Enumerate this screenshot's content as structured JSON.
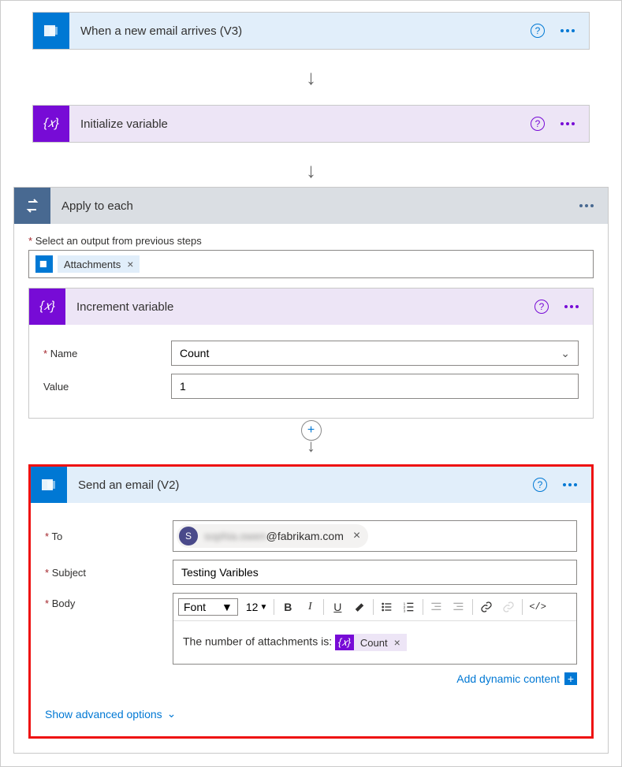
{
  "steps": {
    "trigger": {
      "title": "When a new email arrives (V3)"
    },
    "init_var": {
      "title": "Initialize variable"
    },
    "apply": {
      "title": "Apply to each",
      "select_label": "Select an output from previous steps",
      "token": "Attachments"
    },
    "increment": {
      "title": "Increment variable",
      "name_label": "Name",
      "name_value": "Count",
      "value_label": "Value",
      "value_value": "1"
    },
    "send_email": {
      "title": "Send an email (V2)",
      "to_label": "To",
      "to_name_hidden": "sophia.owen",
      "to_domain": "@fabrikam.com",
      "to_avatar": "S",
      "subject_label": "Subject",
      "subject_value": "Testing Varibles",
      "body_label": "Body",
      "font_label": "Font",
      "font_size": "12",
      "body_text": "The number of attachments is: ",
      "body_token": "Count",
      "dynamic_content": "Add dynamic content",
      "advanced": "Show advanced options"
    }
  },
  "toolbar": {
    "bold": "B",
    "italic": "I",
    "underline": "U",
    "code": "</>"
  }
}
